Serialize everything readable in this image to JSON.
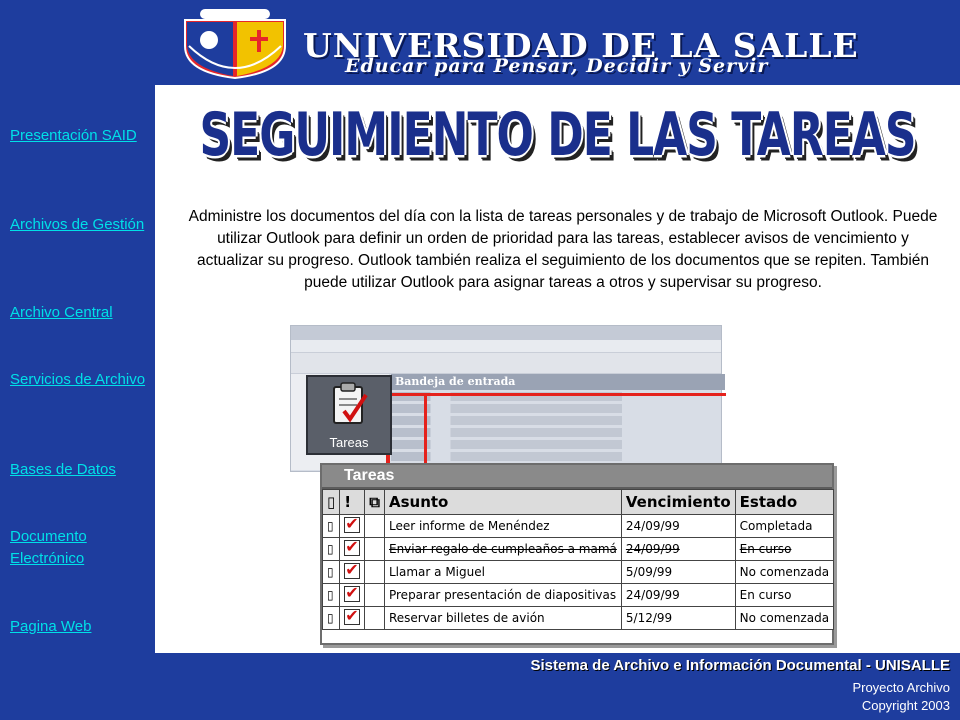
{
  "header": {
    "title": "UNIVERSIDAD DE LA SALLE",
    "motto": "Educar para Pensar, Decidir y Servir"
  },
  "nav": {
    "items": [
      {
        "label": "Presentación SAID"
      },
      {
        "label": "Archivos de Gestión"
      },
      {
        "label": "Archivo Central"
      },
      {
        "label": "Servicios de Archivo"
      },
      {
        "label": "Bases de Datos"
      },
      {
        "label": "Documento Electrónico"
      },
      {
        "label": "Pagina Web"
      }
    ]
  },
  "main": {
    "title": "SEGUIMIENTO DE LAS TAREAS",
    "description": "Administre los documentos del día con la lista de tareas personales y de trabajo de Microsoft Outlook. Puede utilizar Outlook para definir un orden de prioridad para las tareas, establecer avisos de vencimiento y actualizar su progreso. Outlook también realiza el seguimiento de los documentos que se repiten. También puede utilizar Outlook para asignar tareas a otros y supervisar su progreso."
  },
  "screenshot": {
    "inbox_label": "Bandeja de entrada",
    "icon_label": "Tareas",
    "panel_title": "Tareas",
    "columns": {
      "subject": "Asunto",
      "due": "Vencimiento",
      "status": "Estado"
    },
    "tasks": [
      {
        "subject": "Leer informe de Menéndez",
        "due": "24/09/99",
        "status": "Completada"
      },
      {
        "subject": "Enviar regalo de cumpleaños a mamá",
        "due": "24/09/99",
        "status": "En curso"
      },
      {
        "subject": "Llamar a Miguel",
        "due": "5/09/99",
        "status": "No comenzada"
      },
      {
        "subject": "Preparar presentación de diapositivas",
        "due": "24/09/99",
        "status": "En curso"
      },
      {
        "subject": "Reservar billetes de avión",
        "due": "5/12/99",
        "status": "No comenzada"
      }
    ]
  },
  "footer": {
    "title": "Sistema de Archivo e Información Documental - UNISALLE",
    "line2": "Proyecto Archivo",
    "line3": "Copyright  2003"
  },
  "colors": {
    "background": "#1e3d9e",
    "nav_link": "#00e0e8",
    "title": "#1a2f8c",
    "accent_red": "#e5221c"
  }
}
